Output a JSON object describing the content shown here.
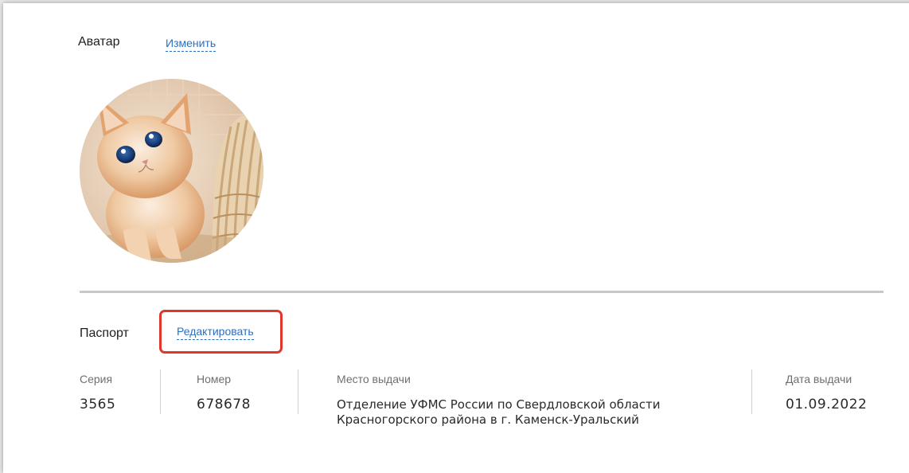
{
  "avatar": {
    "title": "Аватар",
    "change_link": "Изменить",
    "image": "kitten-photo"
  },
  "passport": {
    "title": "Паспорт",
    "edit_link": "Редактировать",
    "fields": {
      "series": {
        "label": "Серия",
        "value": "3565"
      },
      "number": {
        "label": "Номер",
        "value": "678678"
      },
      "place": {
        "label": "Место выдачи",
        "value": "Отделение УФМС России по Свердловской области Красногорского района в г. Каменск-Уральский"
      },
      "date": {
        "label": "Дата выдачи",
        "value": "01.09.2022"
      }
    }
  },
  "colors": {
    "link": "#2b6fc0",
    "highlight": "#e0362b",
    "divider": "#c8c8c8"
  }
}
